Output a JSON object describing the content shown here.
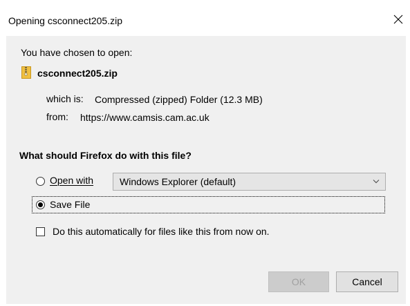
{
  "dialog": {
    "title": "Opening csconnect205.zip",
    "intro": "You have chosen to open:",
    "file_name": "csconnect205.zip",
    "which_is_label": "which is:",
    "which_is_value": "Compressed (zipped) Folder (12.3 MB)",
    "from_label": "from:",
    "from_value": "https://www.camsis.cam.ac.uk",
    "question": "What should Firefox do with this file?",
    "open_with_label": "Open with",
    "open_with_app": "Windows Explorer (default)",
    "save_file_label": "Save File",
    "auto_label": "Do this automatically for files like this from now on.",
    "ok_label": "OK",
    "cancel_label": "Cancel",
    "selected_option": "save-file",
    "auto_checked": false
  },
  "colors": {
    "dialog_background": "#f0f0f0",
    "titlebar_background": "#ffffff",
    "select_background": "#e5e5e5",
    "zip_icon": "#f0c040",
    "disabled_text": "#a0a0a0"
  },
  "icons": {
    "close": "close-icon",
    "file": "zip-file-icon",
    "dropdown": "chevron-down-icon"
  }
}
